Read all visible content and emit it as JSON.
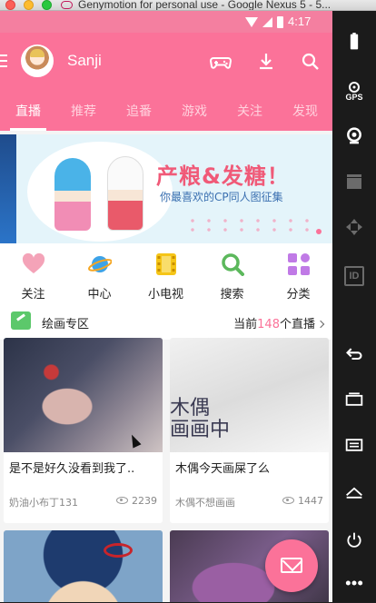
{
  "window": {
    "title": "Genymotion for personal use - Google Nexus 5 - 5..."
  },
  "status_bar": {
    "time": "4:17"
  },
  "toolbar": {
    "username": "Sanji",
    "icons": [
      "menu-icon",
      "gamepad-icon",
      "download-icon",
      "search-icon"
    ]
  },
  "tabs": [
    {
      "label": "直播",
      "active": true
    },
    {
      "label": "推荐",
      "active": false
    },
    {
      "label": "追番",
      "active": false
    },
    {
      "label": "游戏",
      "active": false
    },
    {
      "label": "关注",
      "active": false
    },
    {
      "label": "发现",
      "active": false
    }
  ],
  "banner": {
    "title": "产粮&发糖！",
    "subtitle": "你最喜欢的CP同人图征集"
  },
  "categories": [
    {
      "label": "关注",
      "icon": "heart-icon",
      "color": "#f4a3b8"
    },
    {
      "label": "中心",
      "icon": "planet-icon",
      "color": "#3da3e8"
    },
    {
      "label": "小电视",
      "icon": "film-icon",
      "color": "#f5c518"
    },
    {
      "label": "搜索",
      "icon": "search-icon",
      "color": "#5cb85c"
    },
    {
      "label": "分类",
      "icon": "grid-icon",
      "color": "#c07ae6"
    }
  ],
  "section": {
    "title": "绘画专区",
    "live_prefix": "当前",
    "live_count": "148",
    "live_suffix": "个直播"
  },
  "cards": [
    {
      "title": "是不是好久没看到我了..",
      "owner": "奶油小布丁131",
      "views": "2239"
    },
    {
      "title": "木偶今天画屎了么",
      "owner": "木偶不想画画",
      "views": "1447",
      "thumb_text": "木偶\n画画中"
    }
  ],
  "colors": {
    "brand_pink": "#fb7299",
    "statusbar_pink": "#f47fa0"
  },
  "side_panel": {
    "gps_label": "GPS",
    "id_label": "ID"
  }
}
